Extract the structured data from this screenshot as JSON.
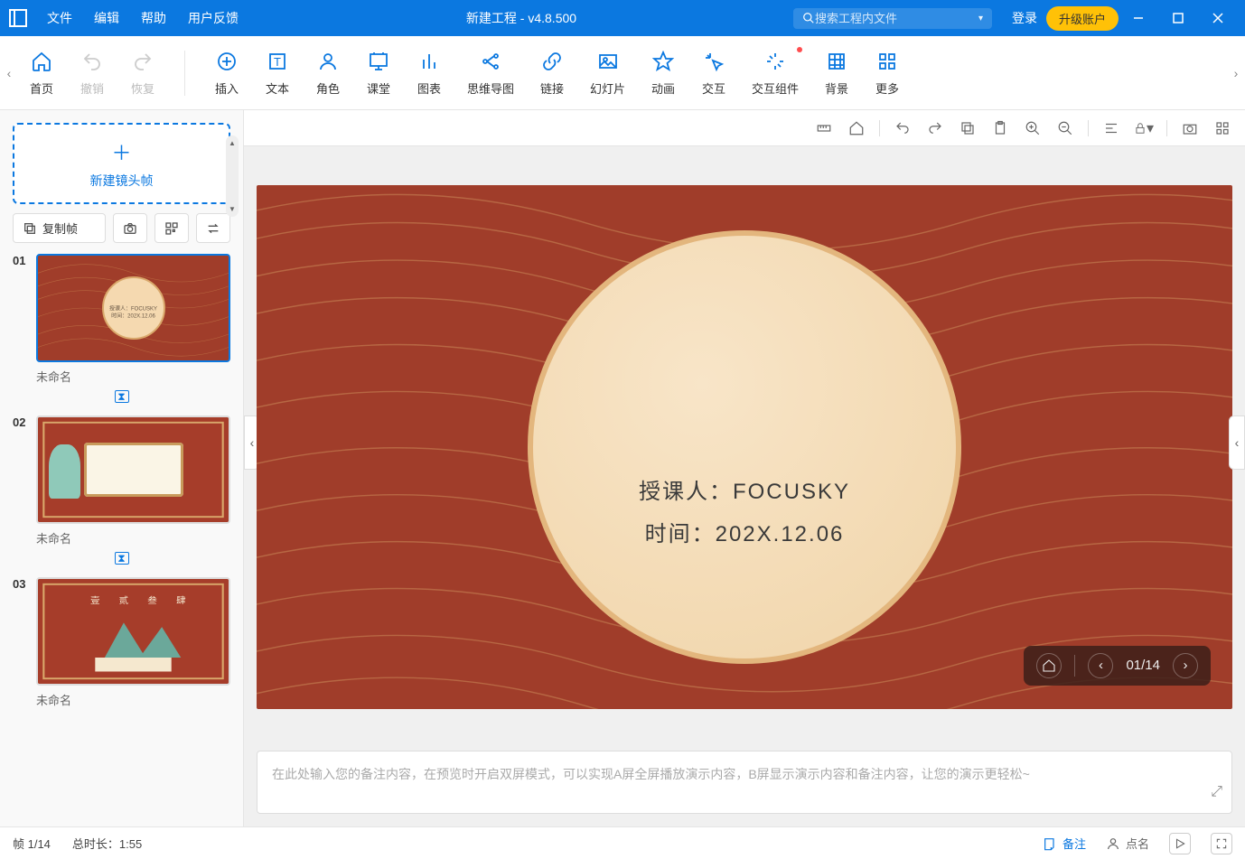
{
  "titlebar": {
    "menu": {
      "file": "文件",
      "edit": "编辑",
      "help": "帮助",
      "feedback": "用户反馈"
    },
    "title": "新建工程 - v4.8.500",
    "search_placeholder": "搜索工程内文件",
    "login": "登录",
    "upgrade": "升级账户"
  },
  "ribbon": {
    "home": "首页",
    "undo": "撤销",
    "redo": "恢复",
    "insert": "插入",
    "text": "文本",
    "role": "角色",
    "classroom": "课堂",
    "chart": "图表",
    "mindmap": "思维导图",
    "link": "链接",
    "slide": "幻灯片",
    "animation": "动画",
    "interaction": "交互",
    "interaction_component": "交互组件",
    "background": "背景",
    "more": "更多"
  },
  "sidebar": {
    "new_frame": "新建镜头帧",
    "copy_frame": "复制帧",
    "slides": [
      {
        "num": "01",
        "label": "未命名"
      },
      {
        "num": "02",
        "label": "未命名"
      },
      {
        "num": "03",
        "label": "未命名"
      }
    ]
  },
  "canvas": {
    "line1": "授课人：FOCUSKY",
    "line2": "时间：202X.12.06",
    "nav_counter": "01/14"
  },
  "notes": {
    "placeholder": "在此处输入您的备注内容，在预览时开启双屏模式，可以实现A屏全屏播放演示内容，B屏显示演示内容和备注内容，让您的演示更轻松~"
  },
  "statusbar": {
    "frame": "帧 1/14",
    "total_time": "总时长：1:55",
    "notes_btn": "备注",
    "roll_call": "点名"
  }
}
